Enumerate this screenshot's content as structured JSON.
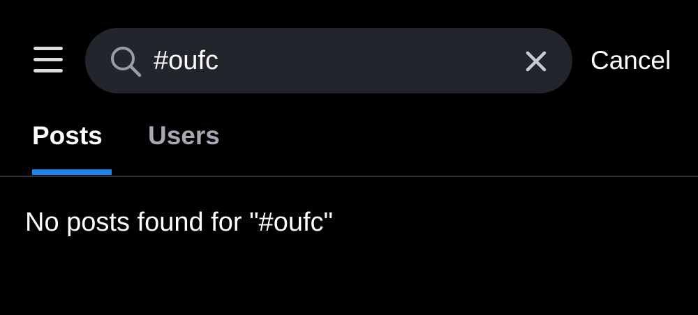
{
  "header": {
    "menu_icon": "hamburger-menu-icon",
    "search": {
      "icon": "search-icon",
      "value": "#oufc",
      "placeholder": "",
      "clear_icon": "close-icon"
    },
    "cancel_label": "Cancel"
  },
  "tabs": [
    {
      "label": "Posts",
      "selected": true
    },
    {
      "label": "Users",
      "selected": false
    }
  ],
  "main": {
    "empty_message": "No posts found for \"#oufc\""
  },
  "colors": {
    "background": "#000000",
    "search_bar": "#23252c",
    "tab_active": "#ffffff",
    "tab_inactive": "#a6a9b3",
    "accent": "#1a84f0",
    "divider": "#2d2f36"
  }
}
